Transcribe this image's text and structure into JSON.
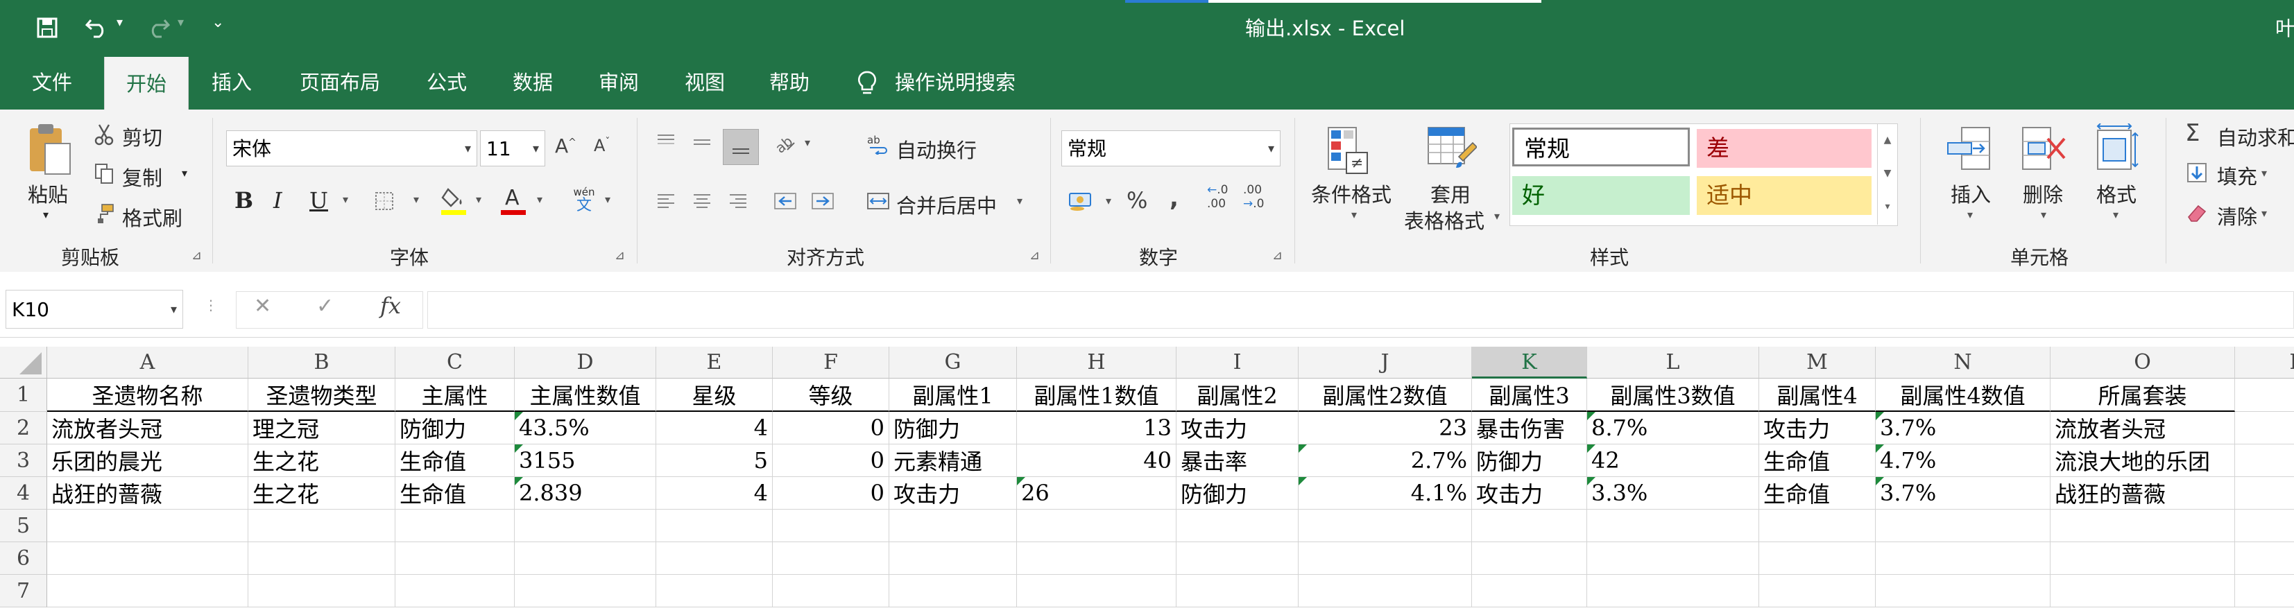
{
  "window": {
    "title": "输出.xlsx  -  Excel",
    "right_cut_text": "叶"
  },
  "tabs": [
    "文件",
    "开始",
    "插入",
    "页面布局",
    "公式",
    "数据",
    "审阅",
    "视图",
    "帮助"
  ],
  "tell_me": "操作说明搜索",
  "clipboard": {
    "paste": "粘贴",
    "cut": "剪切",
    "copy": "复制",
    "format_painter": "格式刷",
    "group": "剪贴板"
  },
  "font": {
    "name": "宋体",
    "size": "11",
    "bold": "B",
    "italic": "I",
    "underline": "U",
    "phonetic": "wén",
    "group": "字体"
  },
  "alignment": {
    "wrap": "自动换行",
    "merge": "合并后居中",
    "group": "对齐方式"
  },
  "number": {
    "format": "常规",
    "group": "数字"
  },
  "styles": {
    "conditional": "条件格式",
    "table_line1": "套用",
    "table_line2": "表格格式",
    "normal": "常规",
    "bad": "差",
    "good": "好",
    "neutral": "适中",
    "group": "样式",
    "colors": {
      "bad_bg": "#ffc7ce",
      "bad_fg": "#9c0006",
      "good_bg": "#c6efce",
      "good_fg": "#006100",
      "neutral_bg": "#ffeb9c",
      "neutral_fg": "#9c5700"
    }
  },
  "cells_group": {
    "insert": "插入",
    "delete": "删除",
    "format": "格式",
    "group": "单元格"
  },
  "editing": {
    "autosum": "自动求和",
    "fill": "填充",
    "clear": "清除"
  },
  "formula_bar": {
    "name_box": "K10",
    "cancel": "✕",
    "enter": "✓",
    "fx": "fx",
    "value": ""
  },
  "sheet": {
    "columns": [
      "A",
      "B",
      "C",
      "D",
      "E",
      "F",
      "G",
      "H",
      "I",
      "J",
      "K",
      "L",
      "M",
      "N",
      "O",
      "P"
    ],
    "selected_column": "K",
    "row_numbers": [
      "1",
      "2",
      "3",
      "4",
      "5",
      "6",
      "7"
    ],
    "rows": [
      [
        "圣遗物名称",
        "圣遗物类型",
        "主属性",
        "主属性数值",
        "星级",
        "等级",
        "副属性1",
        "副属性1数值",
        "副属性2",
        "副属性2数值",
        "副属性3",
        "副属性3数值",
        "副属性4",
        "副属性4数值",
        "所属套装"
      ],
      [
        "流放者头冠",
        "理之冠",
        "防御力",
        "43.5%",
        "4",
        "0",
        "防御力",
        "13",
        "攻击力",
        "23",
        "暴击伤害",
        "8.7%",
        "攻击力",
        "3.7%",
        "流放者头冠"
      ],
      [
        "乐团的晨光",
        "生之花",
        "生命值",
        "3155",
        "5",
        "0",
        "元素精通",
        "40",
        "暴击率",
        "2.7%",
        "防御力",
        "42",
        "生命值",
        "4.7%",
        "流浪大地的乐团"
      ],
      [
        "战狂的蔷薇",
        "生之花",
        "生命值",
        "2.839",
        "4",
        "0",
        "攻击力",
        "26",
        "防御力",
        "4.1%",
        "攻击力",
        "3.3%",
        "生命值",
        "3.7%",
        "战狂的蔷薇"
      ]
    ],
    "accent": "#217346"
  }
}
